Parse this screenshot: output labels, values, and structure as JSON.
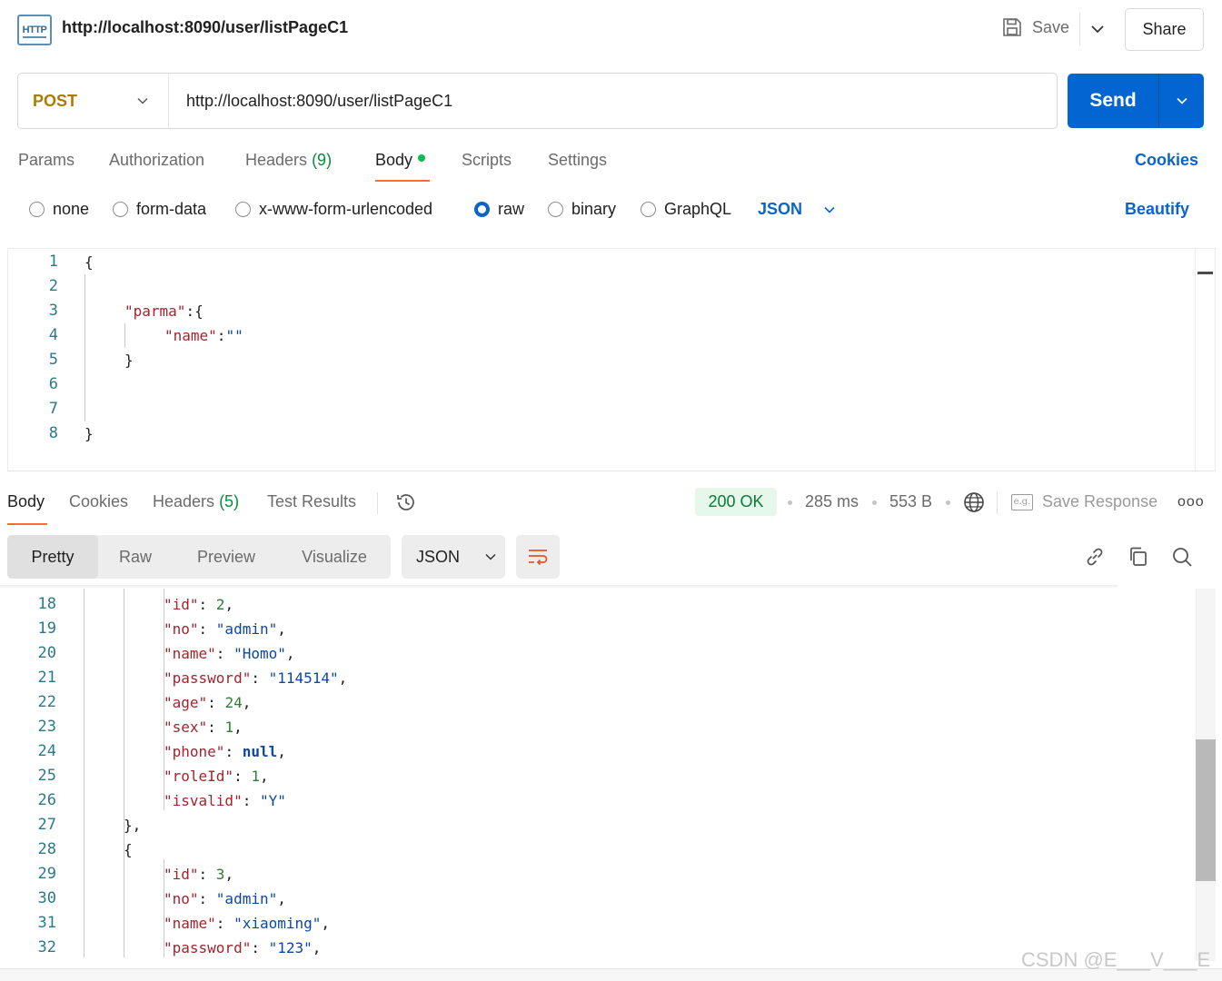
{
  "header": {
    "icon_label": "HTTP",
    "title": "http://localhost:8090/user/listPageC1",
    "save_label": "Save",
    "share_label": "Share"
  },
  "request": {
    "method": "POST",
    "url": "http://localhost:8090/user/listPageC1",
    "send_label": "Send"
  },
  "request_tabs": {
    "params": "Params",
    "authorization": "Authorization",
    "headers": "Headers",
    "headers_count": "(9)",
    "body": "Body",
    "scripts": "Scripts",
    "settings": "Settings",
    "cookies": "Cookies"
  },
  "body_types": {
    "none": "none",
    "form_data": "form-data",
    "urlencoded": "x-www-form-urlencoded",
    "raw": "raw",
    "binary": "binary",
    "graphql": "GraphQL",
    "format": "JSON",
    "beautify": "Beautify"
  },
  "request_body": {
    "line_numbers": [
      "1",
      "2",
      "3",
      "4",
      "5",
      "6",
      "7",
      "8"
    ],
    "key_parma": "\"parma\"",
    "key_name": "\"name\"",
    "value_empty": "\"\""
  },
  "response_tabs": {
    "body": "Body",
    "cookies": "Cookies",
    "headers": "Headers",
    "headers_count": "(5)",
    "test_results": "Test Results"
  },
  "response_meta": {
    "status": "200 OK",
    "time": "285 ms",
    "size": "553 B",
    "save_response": "Save Response",
    "eg_icon": "e.g."
  },
  "response_view": {
    "pretty": "Pretty",
    "raw": "Raw",
    "preview": "Preview",
    "visualize": "Visualize",
    "format": "JSON"
  },
  "response_body": {
    "lines": [
      {
        "n": "18",
        "indent": 3,
        "key": "\"id\"",
        "val": "2",
        "type": "num",
        "comma": true
      },
      {
        "n": "19",
        "indent": 3,
        "key": "\"no\"",
        "val": "\"admin\"",
        "type": "str",
        "comma": true
      },
      {
        "n": "20",
        "indent": 3,
        "key": "\"name\"",
        "val": "\"Homo\"",
        "type": "str",
        "comma": true
      },
      {
        "n": "21",
        "indent": 3,
        "key": "\"password\"",
        "val": "\"114514\"",
        "type": "str",
        "comma": true
      },
      {
        "n": "22",
        "indent": 3,
        "key": "\"age\"",
        "val": "24",
        "type": "num",
        "comma": true
      },
      {
        "n": "23",
        "indent": 3,
        "key": "\"sex\"",
        "val": "1",
        "type": "num",
        "comma": true
      },
      {
        "n": "24",
        "indent": 3,
        "key": "\"phone\"",
        "val": "null",
        "type": "kw",
        "comma": true
      },
      {
        "n": "25",
        "indent": 3,
        "key": "\"roleId\"",
        "val": "1",
        "type": "num",
        "comma": true
      },
      {
        "n": "26",
        "indent": 3,
        "key": "\"isvalid\"",
        "val": "\"Y\"",
        "type": "str",
        "comma": false
      },
      {
        "n": "27",
        "indent": 2,
        "punct": "},"
      },
      {
        "n": "28",
        "indent": 2,
        "punct": "{"
      },
      {
        "n": "29",
        "indent": 3,
        "key": "\"id\"",
        "val": "3",
        "type": "num",
        "comma": true
      },
      {
        "n": "30",
        "indent": 3,
        "key": "\"no\"",
        "val": "\"admin\"",
        "type": "str",
        "comma": true
      },
      {
        "n": "31",
        "indent": 3,
        "key": "\"name\"",
        "val": "\"xiaoming\"",
        "type": "str",
        "comma": true
      },
      {
        "n": "32",
        "indent": 3,
        "key": "\"password\"",
        "val": "\"123\"",
        "type": "str",
        "comma": true
      }
    ]
  },
  "watermark": "CSDN @E___V___E",
  "colors": {
    "send_blue": "#0265d2",
    "link_blue": "#0b64c9",
    "method_post": "#ad7a03",
    "status_green": "#0b7a37",
    "tab_accent": "#ff6c37",
    "json_key": "#a1252d",
    "json_string": "#0d47a1",
    "json_number": "#2e7d32"
  },
  "icons": [
    "http-icon",
    "save-icon",
    "chevron-down-icon",
    "history-icon",
    "globe-icon",
    "more-icon",
    "wrap-lines-icon",
    "link-icon",
    "copy-icon",
    "search-icon"
  ]
}
